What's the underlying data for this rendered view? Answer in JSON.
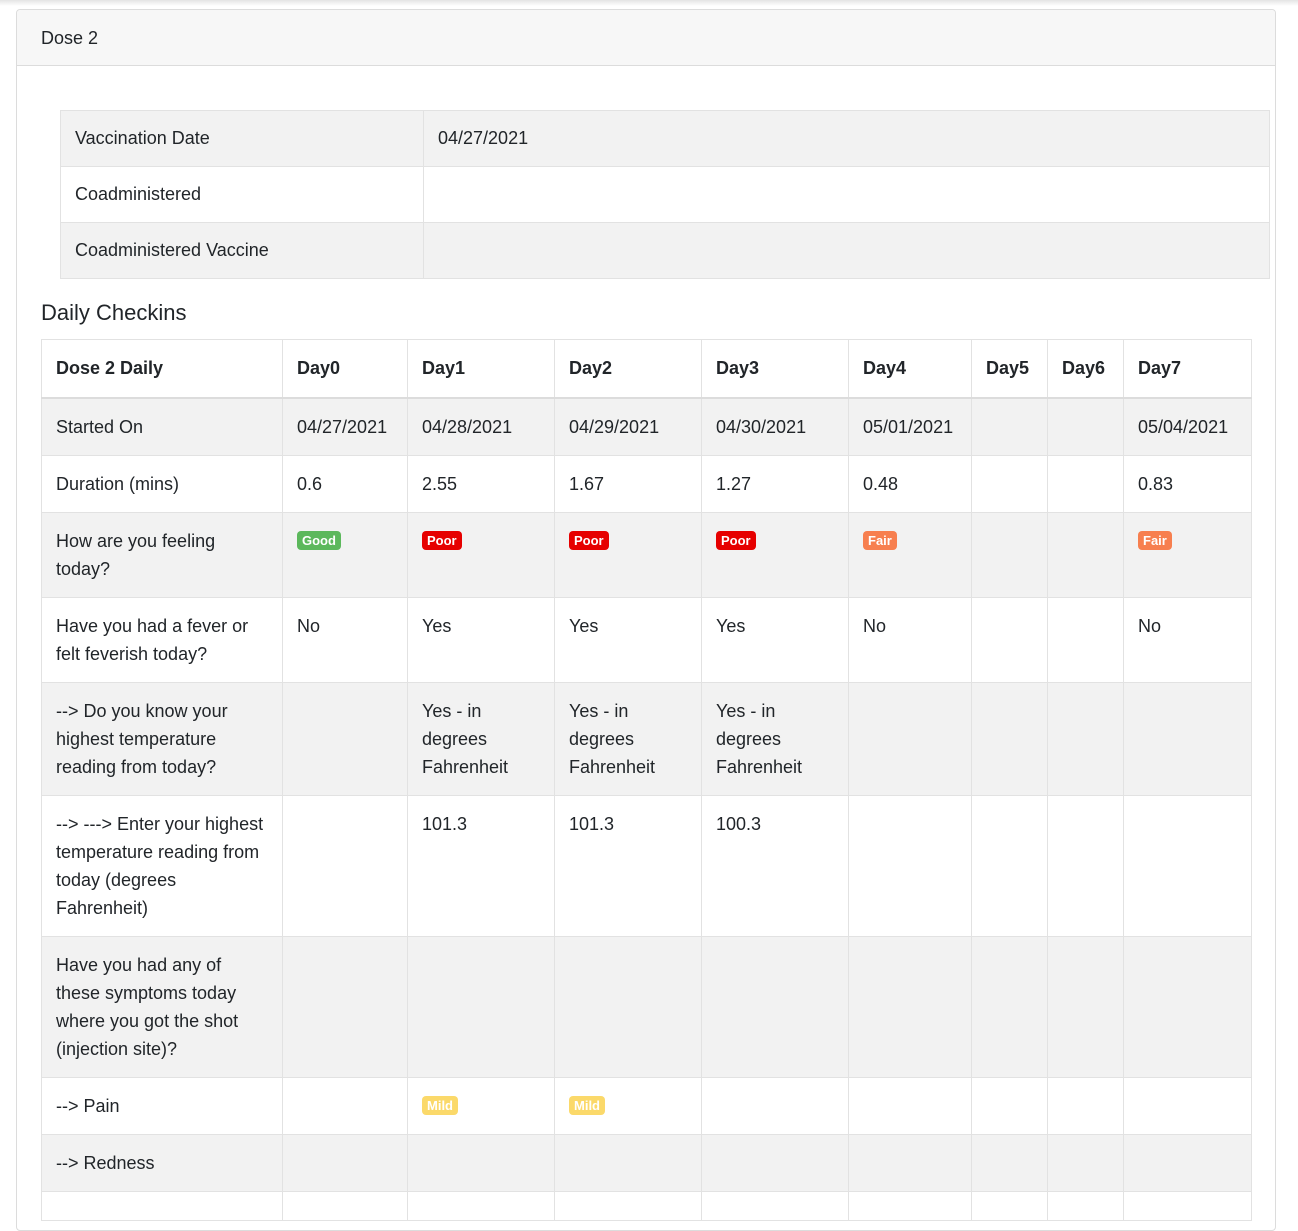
{
  "panel": {
    "title": "Dose 2"
  },
  "vaccination_info": [
    {
      "label": "Vaccination Date",
      "value": "04/27/2021"
    },
    {
      "label": "Coadministered",
      "value": ""
    },
    {
      "label": "Coadministered Vaccine",
      "value": ""
    }
  ],
  "daily_checkins": {
    "title": "Daily Checkins",
    "columns": [
      "Dose 2 Daily",
      "Day0",
      "Day1",
      "Day2",
      "Day3",
      "Day4",
      "Day5",
      "Day6",
      "Day7"
    ],
    "rows": [
      {
        "question": "Started On",
        "cells": [
          {
            "text": "04/27/2021"
          },
          {
            "text": "04/28/2021"
          },
          {
            "text": "04/29/2021"
          },
          {
            "text": "04/30/2021"
          },
          {
            "text": "05/01/2021"
          },
          {
            "text": ""
          },
          {
            "text": ""
          },
          {
            "text": "05/04/2021"
          }
        ]
      },
      {
        "question": "Duration (mins)",
        "cells": [
          {
            "text": "0.6"
          },
          {
            "text": "2.55"
          },
          {
            "text": "1.67"
          },
          {
            "text": "1.27"
          },
          {
            "text": "0.48"
          },
          {
            "text": ""
          },
          {
            "text": ""
          },
          {
            "text": "0.83"
          }
        ]
      },
      {
        "question": "How are you feeling today?",
        "cells": [
          {
            "badge": "Good",
            "color": "#5cb85c"
          },
          {
            "badge": "Poor",
            "color": "#e60000"
          },
          {
            "badge": "Poor",
            "color": "#e60000"
          },
          {
            "badge": "Poor",
            "color": "#e60000"
          },
          {
            "badge": "Fair",
            "color": "#f77f4f"
          },
          {
            "text": ""
          },
          {
            "text": ""
          },
          {
            "badge": "Fair",
            "color": "#f77f4f"
          }
        ]
      },
      {
        "question": "Have you had a fever or felt feverish today?",
        "cells": [
          {
            "text": "No"
          },
          {
            "text": "Yes"
          },
          {
            "text": "Yes"
          },
          {
            "text": "Yes"
          },
          {
            "text": "No"
          },
          {
            "text": ""
          },
          {
            "text": ""
          },
          {
            "text": "No"
          }
        ]
      },
      {
        "question": "--> Do you know your highest temperature reading from today?",
        "cells": [
          {
            "text": ""
          },
          {
            "text": "Yes - in degrees Fahrenheit"
          },
          {
            "text": "Yes - in degrees Fahrenheit"
          },
          {
            "text": "Yes - in degrees Fahrenheit"
          },
          {
            "text": ""
          },
          {
            "text": ""
          },
          {
            "text": ""
          },
          {
            "text": ""
          }
        ]
      },
      {
        "question": "--> ---> Enter your highest temperature reading from today (degrees Fahrenheit)",
        "cells": [
          {
            "text": ""
          },
          {
            "text": "101.3"
          },
          {
            "text": "101.3"
          },
          {
            "text": "100.3"
          },
          {
            "text": ""
          },
          {
            "text": ""
          },
          {
            "text": ""
          },
          {
            "text": ""
          }
        ]
      },
      {
        "question": "Have you had any of these symptoms today where you got the shot (injection site)?",
        "cells": [
          {
            "text": ""
          },
          {
            "text": ""
          },
          {
            "text": ""
          },
          {
            "text": ""
          },
          {
            "text": ""
          },
          {
            "text": ""
          },
          {
            "text": ""
          },
          {
            "text": ""
          }
        ]
      },
      {
        "question": "--> Pain",
        "cells": [
          {
            "text": ""
          },
          {
            "badge": "Mild",
            "color": "#fbd96a"
          },
          {
            "badge": "Mild",
            "color": "#fbd96a"
          },
          {
            "text": ""
          },
          {
            "text": ""
          },
          {
            "text": ""
          },
          {
            "text": ""
          },
          {
            "text": ""
          }
        ]
      },
      {
        "question": "--> Redness",
        "cells": [
          {
            "text": ""
          },
          {
            "text": ""
          },
          {
            "text": ""
          },
          {
            "text": ""
          },
          {
            "text": ""
          },
          {
            "text": ""
          },
          {
            "text": ""
          },
          {
            "text": ""
          }
        ]
      },
      {
        "question": "",
        "cells": [
          {
            "text": ""
          },
          {
            "text": ""
          },
          {
            "text": ""
          },
          {
            "text": ""
          },
          {
            "text": ""
          },
          {
            "text": ""
          },
          {
            "text": ""
          },
          {
            "text": ""
          }
        ]
      }
    ]
  }
}
